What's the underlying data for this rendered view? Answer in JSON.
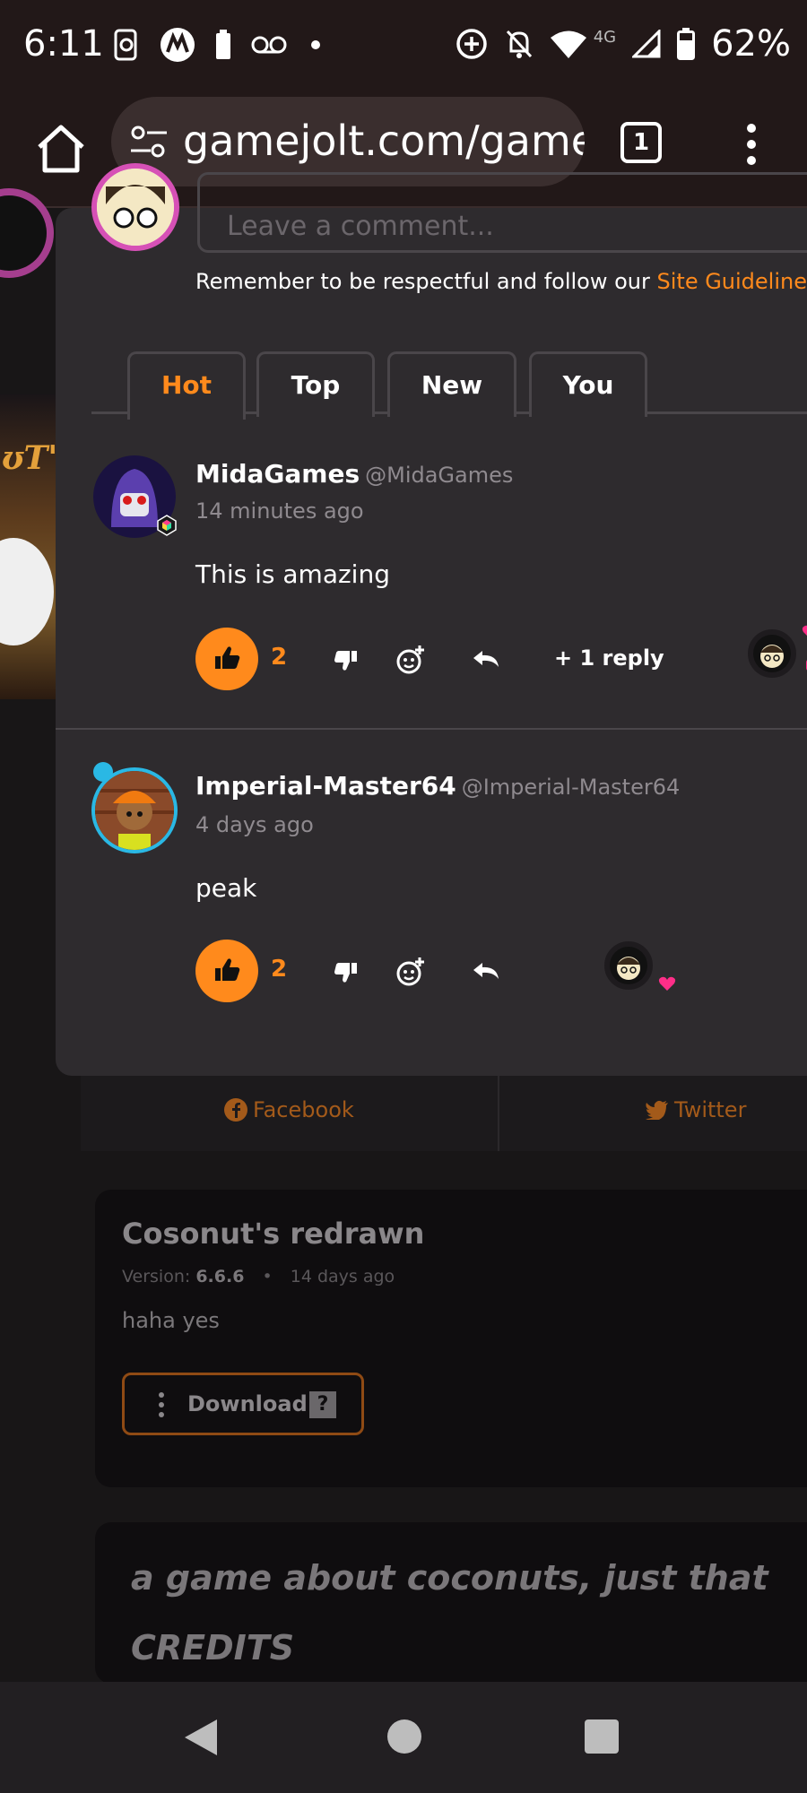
{
  "status_bar": {
    "time": "6:11",
    "network": "4G",
    "battery": "62%",
    "icons": [
      "phone-sync-icon",
      "motorola-icon",
      "battery-small-icon",
      "voicemail-icon",
      "dot-icon",
      "data-saver-icon",
      "bell-off-icon",
      "wifi-icon",
      "signal-icon",
      "battery-icon"
    ]
  },
  "browser": {
    "url": "gamejolt.com/game",
    "tab_count": "1"
  },
  "composer": {
    "placeholder": "Leave a comment...",
    "guidelines_text": "Remember to be respectful and follow our ",
    "guidelines_link": "Site Guidelines",
    "guidelines_end": "."
  },
  "tabs": [
    {
      "label": "Hot",
      "active": true
    },
    {
      "label": "Top",
      "active": false
    },
    {
      "label": "New",
      "active": false
    },
    {
      "label": "You",
      "active": false
    }
  ],
  "comments": [
    {
      "author": "MidaGames",
      "handle": "@MidaGames",
      "time": "14 minutes ago",
      "body": "This is amazing",
      "likes": "2",
      "replies": "+ 1 reply"
    },
    {
      "author": "Imperial-Master64",
      "handle": "@Imperial-Master64",
      "time": "4 days ago",
      "body": "peak",
      "likes": "2"
    }
  ],
  "share": {
    "facebook": "Facebook",
    "twitter": "Twitter"
  },
  "release": {
    "title": "Cosonut's redrawn",
    "version_label": "Version:",
    "version": "6.6.6",
    "date": "14 days ago",
    "description": "haha yes",
    "download_label": "Download",
    "download_badge": "?"
  },
  "description": {
    "line1": "a game about coconuts, just that",
    "line2": "CREDITS"
  },
  "colors": {
    "accent": "#ff8a1c",
    "heart": "#ff2e88",
    "modal_bg": "#2e2b2e"
  }
}
